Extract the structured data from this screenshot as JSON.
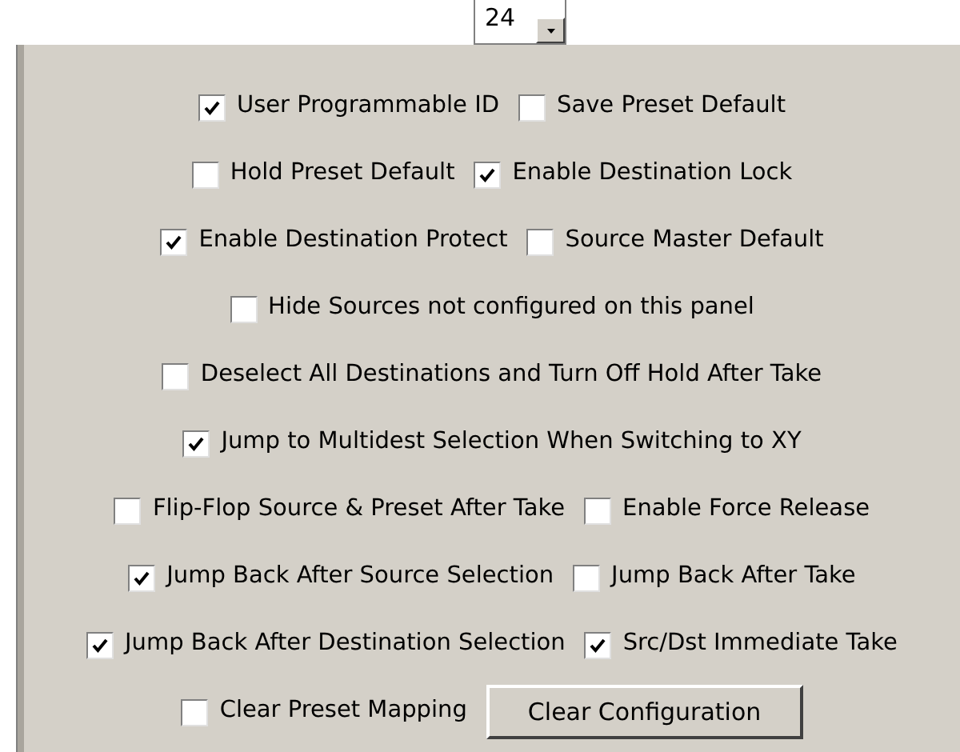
{
  "combo": {
    "value": "24"
  },
  "rows": [
    [
      {
        "kind": "checkbox",
        "label": "User Programmable ID",
        "checked": true
      },
      {
        "kind": "checkbox",
        "label": "Save Preset Default",
        "checked": false
      }
    ],
    [
      {
        "kind": "checkbox",
        "label": "Hold Preset Default",
        "checked": false
      },
      {
        "kind": "checkbox",
        "label": "Enable Destination Lock",
        "checked": true
      }
    ],
    [
      {
        "kind": "checkbox",
        "label": "Enable Destination Protect",
        "checked": true
      },
      {
        "kind": "checkbox",
        "label": "Source Master Default",
        "checked": false
      }
    ],
    [
      {
        "kind": "checkbox",
        "label": "Hide Sources not configured on this panel",
        "checked": false
      }
    ],
    [
      {
        "kind": "checkbox",
        "label": "Deselect All Destinations and Turn Off Hold After Take",
        "checked": false
      }
    ],
    [
      {
        "kind": "checkbox",
        "label": "Jump to Multidest Selection When Switching to XY",
        "checked": true
      }
    ],
    [
      {
        "kind": "checkbox",
        "label": "Flip-Flop Source & Preset After Take",
        "checked": false
      },
      {
        "kind": "checkbox",
        "label": "Enable Force Release",
        "checked": false
      }
    ],
    [
      {
        "kind": "checkbox",
        "label": "Jump Back After Source Selection",
        "checked": true
      },
      {
        "kind": "checkbox",
        "label": "Jump Back After Take",
        "checked": false
      }
    ],
    [
      {
        "kind": "checkbox",
        "label": "Jump Back After Destination Selection",
        "checked": true
      },
      {
        "kind": "checkbox",
        "label": "Src/Dst Immediate Take",
        "checked": true
      }
    ],
    [
      {
        "kind": "checkbox",
        "label": "Clear Preset Mapping",
        "checked": false
      },
      {
        "kind": "button",
        "label": "Clear Configuration"
      }
    ]
  ]
}
